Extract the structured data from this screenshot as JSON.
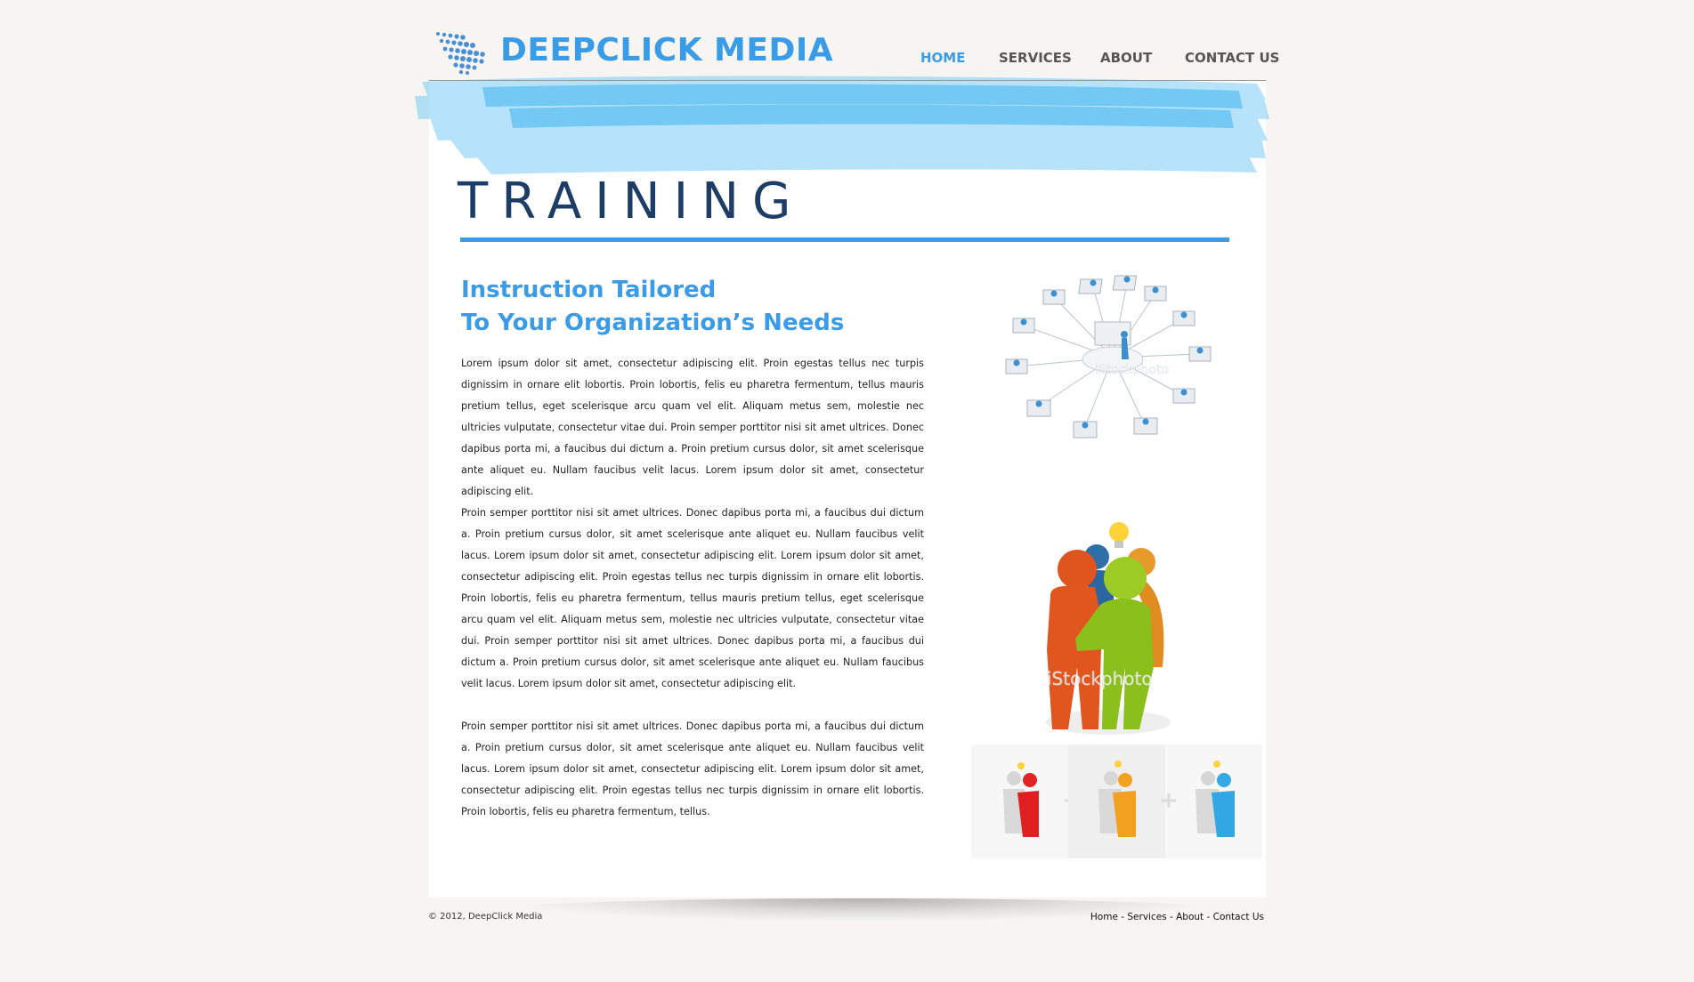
{
  "brand": {
    "name": "DEEPCLICK MEDIA",
    "color": "#3a9be6"
  },
  "nav": {
    "items": [
      {
        "label": "HOME",
        "active": true
      },
      {
        "label": "SERVICES",
        "active": false
      },
      {
        "label": "ABOUT",
        "active": false
      },
      {
        "label": "CONTACT US",
        "active": false
      }
    ]
  },
  "page": {
    "title": "TRAINING",
    "subheading_line1": "Instruction Tailored",
    "subheading_line2": "To Your Organization’s Needs",
    "paragraphs": [
      "Lorem ipsum dolor sit amet, consectetur adipiscing elit. Proin egestas tellus nec turpis dignissim in ornare elit lobortis. Proin lobortis, felis eu pharetra fermentum, tellus mauris pretium tellus, eget scelerisque arcu quam vel elit. Aliquam metus sem, molestie nec ultricies vulputate, consectetur vitae dui. Proin semper porttitor nisi sit amet ultrices. Donec dapibus porta mi, a faucibus dui dictum a. Proin pretium cursus dolor, sit amet scelerisque ante aliquet eu. Nullam faucibus velit lacus. Lorem ipsum dolor sit amet, consectetur adipiscing elit.",
      "Proin semper porttitor nisi sit amet ultrices. Donec dapibus porta mi, a faucibus dui dictum a. Proin pretium cursus dolor, sit amet scelerisque ante aliquet eu. Nullam faucibus velit lacus. Lorem ipsum dolor sit amet, consectetur adipiscing elit.  Lorem ipsum dolor sit amet, consectetur adipiscing elit. Proin egestas tellus nec turpis dignissim in ornare elit lobortis. Proin lobortis, felis eu pharetra fermentum, tellus mauris pretium tellus, eget scelerisque arcu quam vel elit. Aliquam metus sem, molestie nec ultricies vulputate, consectetur vitae dui. Proin semper porttitor nisi sit amet ultrices. Donec dapibus porta mi, a faucibus dui dictum a. Proin pretium cursus dolor, sit amet scelerisque ante aliquet eu. Nullam faucibus velit lacus. Lorem ipsum dolor sit amet, consectetur adipiscing elit.",
      "Proin semper porttitor nisi sit amet ultrices. Donec dapibus porta mi, a faucibus dui dictum a. Proin pretium cursus dolor, sit amet scelerisque ante aliquet eu. Nullam faucibus velit lacus. Lorem ipsum dolor sit amet, consectetur adipiscing elit. Lorem ipsum dolor sit amet, consectetur adipiscing elit. Proin egestas tellus nec turpis dignissim in ornare elit lobortis. Proin lobortis, felis eu pharetra fermentum, tellus."
    ]
  },
  "images": {
    "network_watermark": "iStockphoto",
    "team_watermark": "iStockphoto",
    "variant_separator": "+"
  },
  "footer": {
    "copyright": "© 2012, DeepClick Media",
    "links": [
      "Home",
      "Services",
      "About",
      "Contact Us"
    ],
    "separator": " - "
  },
  "icons": {
    "logo": "dot-grid-logo-icon",
    "network": "network-workstations-icon",
    "team": "team-huddle-lightbulb-icon"
  }
}
